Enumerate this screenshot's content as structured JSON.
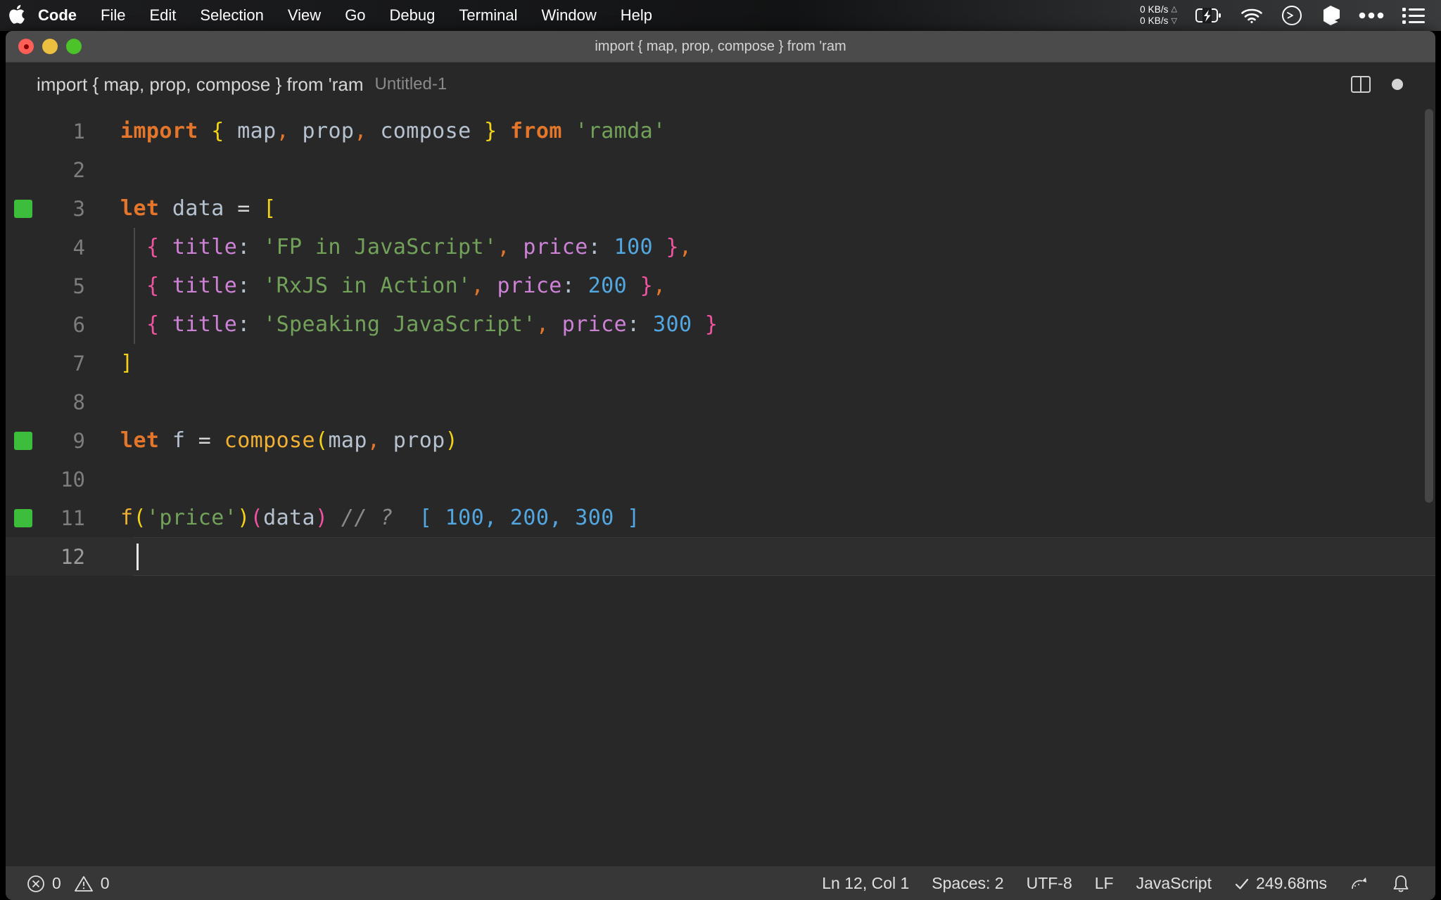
{
  "menubar": {
    "apple_icon": "apple-logo-icon",
    "items": [
      {
        "label": "Code",
        "bold": true
      },
      {
        "label": "File",
        "bold": false
      },
      {
        "label": "Edit",
        "bold": false
      },
      {
        "label": "Selection",
        "bold": false
      },
      {
        "label": "View",
        "bold": false
      },
      {
        "label": "Go",
        "bold": false
      },
      {
        "label": "Debug",
        "bold": false
      },
      {
        "label": "Terminal",
        "bold": false
      },
      {
        "label": "Window",
        "bold": false
      },
      {
        "label": "Help",
        "bold": false
      }
    ],
    "status": {
      "net_up": "0 KB/s",
      "net_down": "0 KB/s",
      "up_arrow": "△",
      "down_arrow": "▽",
      "battery_icon": "battery-charging-icon",
      "wifi_icon": "wifi-icon",
      "clock_icon": "clock-icon",
      "shape_icon": "cube-icon",
      "dots_icon": "ellipsis-icon",
      "list_icon": "control-center-list-icon"
    }
  },
  "window": {
    "title": "import { map, prop, compose } from 'ram",
    "traffic": {
      "close": "close-button",
      "minimize": "minimize-button",
      "maximize": "maximize-button"
    }
  },
  "breadcrumb": {
    "primary": "import { map, prop, compose } from 'ram",
    "secondary": "Untitled-1",
    "split_editor_icon": "split-editor-icon",
    "unsaved_indicator": "unsaved-dot-icon"
  },
  "editor": {
    "language_mode": "JavaScript",
    "lines": [
      {
        "number": "1",
        "breakpoint": false,
        "indent_guide": false,
        "current": false,
        "tokens": [
          {
            "text": "import",
            "cls": "t-kw"
          },
          {
            "text": " ",
            "cls": "t-punct"
          },
          {
            "text": "{",
            "cls": "t-brace"
          },
          {
            "text": " ",
            "cls": "t-punct"
          },
          {
            "text": "map",
            "cls": "t-ident"
          },
          {
            "text": ",",
            "cls": "t-comma"
          },
          {
            "text": " ",
            "cls": "t-punct"
          },
          {
            "text": "prop",
            "cls": "t-ident"
          },
          {
            "text": ",",
            "cls": "t-comma"
          },
          {
            "text": " ",
            "cls": "t-punct"
          },
          {
            "text": "compose",
            "cls": "t-ident"
          },
          {
            "text": " ",
            "cls": "t-punct"
          },
          {
            "text": "}",
            "cls": "t-brace"
          },
          {
            "text": " ",
            "cls": "t-punct"
          },
          {
            "text": "from",
            "cls": "t-kw"
          },
          {
            "text": " ",
            "cls": "t-punct"
          },
          {
            "text": "'ramda'",
            "cls": "t-str"
          }
        ]
      },
      {
        "number": "2",
        "breakpoint": false,
        "indent_guide": false,
        "current": false,
        "tokens": []
      },
      {
        "number": "3",
        "breakpoint": true,
        "indent_guide": false,
        "current": false,
        "tokens": [
          {
            "text": "let",
            "cls": "t-kw"
          },
          {
            "text": " ",
            "cls": "t-punct"
          },
          {
            "text": "data",
            "cls": "t-ident"
          },
          {
            "text": " ",
            "cls": "t-punct"
          },
          {
            "text": "=",
            "cls": "t-punct"
          },
          {
            "text": " ",
            "cls": "t-punct"
          },
          {
            "text": "[",
            "cls": "t-brace"
          }
        ]
      },
      {
        "number": "4",
        "breakpoint": false,
        "indent_guide": true,
        "current": false,
        "tokens": [
          {
            "text": "  ",
            "cls": "t-punct"
          },
          {
            "text": "{",
            "cls": "t-curly"
          },
          {
            "text": " ",
            "cls": "t-punct"
          },
          {
            "text": "title",
            "cls": "t-prop"
          },
          {
            "text": ":",
            "cls": "t-colon"
          },
          {
            "text": " ",
            "cls": "t-punct"
          },
          {
            "text": "'FP in JavaScript'",
            "cls": "t-str"
          },
          {
            "text": ",",
            "cls": "t-comma"
          },
          {
            "text": " ",
            "cls": "t-punct"
          },
          {
            "text": "price",
            "cls": "t-prop"
          },
          {
            "text": ":",
            "cls": "t-colon"
          },
          {
            "text": " ",
            "cls": "t-punct"
          },
          {
            "text": "100",
            "cls": "t-num"
          },
          {
            "text": " ",
            "cls": "t-punct"
          },
          {
            "text": "}",
            "cls": "t-curly"
          },
          {
            "text": ",",
            "cls": "t-comma"
          }
        ]
      },
      {
        "number": "5",
        "breakpoint": false,
        "indent_guide": true,
        "current": false,
        "tokens": [
          {
            "text": "  ",
            "cls": "t-punct"
          },
          {
            "text": "{",
            "cls": "t-curly"
          },
          {
            "text": " ",
            "cls": "t-punct"
          },
          {
            "text": "title",
            "cls": "t-prop"
          },
          {
            "text": ":",
            "cls": "t-colon"
          },
          {
            "text": " ",
            "cls": "t-punct"
          },
          {
            "text": "'RxJS in Action'",
            "cls": "t-str"
          },
          {
            "text": ",",
            "cls": "t-comma"
          },
          {
            "text": " ",
            "cls": "t-punct"
          },
          {
            "text": "price",
            "cls": "t-prop"
          },
          {
            "text": ":",
            "cls": "t-colon"
          },
          {
            "text": " ",
            "cls": "t-punct"
          },
          {
            "text": "200",
            "cls": "t-num"
          },
          {
            "text": " ",
            "cls": "t-punct"
          },
          {
            "text": "}",
            "cls": "t-curly"
          },
          {
            "text": ",",
            "cls": "t-comma"
          }
        ]
      },
      {
        "number": "6",
        "breakpoint": false,
        "indent_guide": true,
        "current": false,
        "tokens": [
          {
            "text": "  ",
            "cls": "t-punct"
          },
          {
            "text": "{",
            "cls": "t-curly"
          },
          {
            "text": " ",
            "cls": "t-punct"
          },
          {
            "text": "title",
            "cls": "t-prop"
          },
          {
            "text": ":",
            "cls": "t-colon"
          },
          {
            "text": " ",
            "cls": "t-punct"
          },
          {
            "text": "'Speaking JavaScript'",
            "cls": "t-str"
          },
          {
            "text": ",",
            "cls": "t-comma"
          },
          {
            "text": " ",
            "cls": "t-punct"
          },
          {
            "text": "price",
            "cls": "t-prop"
          },
          {
            "text": ":",
            "cls": "t-colon"
          },
          {
            "text": " ",
            "cls": "t-punct"
          },
          {
            "text": "300",
            "cls": "t-num"
          },
          {
            "text": " ",
            "cls": "t-punct"
          },
          {
            "text": "}",
            "cls": "t-curly"
          }
        ]
      },
      {
        "number": "7",
        "breakpoint": false,
        "indent_guide": false,
        "current": false,
        "tokens": [
          {
            "text": "]",
            "cls": "t-brace"
          }
        ]
      },
      {
        "number": "8",
        "breakpoint": false,
        "indent_guide": false,
        "current": false,
        "tokens": []
      },
      {
        "number": "9",
        "breakpoint": true,
        "indent_guide": false,
        "current": false,
        "tokens": [
          {
            "text": "let",
            "cls": "t-kw"
          },
          {
            "text": " ",
            "cls": "t-punct"
          },
          {
            "text": "f",
            "cls": "t-ident"
          },
          {
            "text": " ",
            "cls": "t-punct"
          },
          {
            "text": "=",
            "cls": "t-punct"
          },
          {
            "text": " ",
            "cls": "t-punct"
          },
          {
            "text": "compose",
            "cls": "t-fn"
          },
          {
            "text": "(",
            "cls": "t-brace"
          },
          {
            "text": "map",
            "cls": "t-ident"
          },
          {
            "text": ",",
            "cls": "t-comma"
          },
          {
            "text": " ",
            "cls": "t-punct"
          },
          {
            "text": "prop",
            "cls": "t-ident"
          },
          {
            "text": ")",
            "cls": "t-brace"
          }
        ]
      },
      {
        "number": "10",
        "breakpoint": false,
        "indent_guide": false,
        "current": false,
        "tokens": []
      },
      {
        "number": "11",
        "breakpoint": true,
        "indent_guide": false,
        "current": false,
        "tokens": [
          {
            "text": "f",
            "cls": "t-fn"
          },
          {
            "text": "(",
            "cls": "t-brace"
          },
          {
            "text": "'price'",
            "cls": "t-str"
          },
          {
            "text": ")",
            "cls": "t-brace"
          },
          {
            "text": "(",
            "cls": "t-curly"
          },
          {
            "text": "data",
            "cls": "t-ident"
          },
          {
            "text": ")",
            "cls": "t-curly"
          },
          {
            "text": " ",
            "cls": "t-punct"
          },
          {
            "text": "// ?",
            "cls": "t-comment"
          },
          {
            "text": "  ",
            "cls": "t-punct"
          },
          {
            "text": "[",
            "cls": "t-num"
          },
          {
            "text": " ",
            "cls": "t-punct"
          },
          {
            "text": "100",
            "cls": "t-num"
          },
          {
            "text": ",",
            "cls": "t-num"
          },
          {
            "text": " ",
            "cls": "t-punct"
          },
          {
            "text": "200",
            "cls": "t-num"
          },
          {
            "text": ",",
            "cls": "t-num"
          },
          {
            "text": " ",
            "cls": "t-punct"
          },
          {
            "text": "300",
            "cls": "t-num"
          },
          {
            "text": " ",
            "cls": "t-punct"
          },
          {
            "text": "]",
            "cls": "t-num"
          }
        ]
      },
      {
        "number": "12",
        "breakpoint": false,
        "indent_guide": false,
        "current": true,
        "tokens": []
      }
    ]
  },
  "statusbar": {
    "error_icon": "error-circle-icon",
    "error_count": "0",
    "warning_icon": "warning-triangle-icon",
    "warning_count": "0",
    "cursor_position": "Ln 12, Col 1",
    "indentation": "Spaces: 2",
    "encoding": "UTF-8",
    "eol": "LF",
    "language": "JavaScript",
    "run_status": "249.68ms",
    "run_check_icon": "check-icon",
    "feedback_icon": "feedback-smiley-icon",
    "notifications_icon": "bell-icon"
  },
  "colors": {
    "keyword": "#e3762b",
    "string": "#72a25a",
    "number": "#53a7e0",
    "property": "#cd82d6",
    "brace": "#f2d218",
    "curly": "#f0539f",
    "function": "#f2b134",
    "comment": "#8a8a8a",
    "editor_bg": "#282828",
    "statusbar_bg": "#373737",
    "breakpoint": "#3cbe3c"
  }
}
